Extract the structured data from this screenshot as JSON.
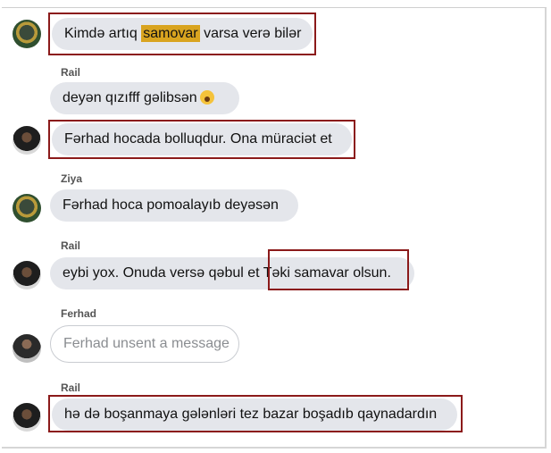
{
  "messages": [
    {
      "sender": "",
      "text_before": "Kimdə artıq ",
      "highlight": "samovar",
      "text_after": " varsa verə bilər"
    },
    {
      "sender": "Rail",
      "text": "deyən qızıfff gəlibsən",
      "emoji": "astonished-emoji"
    },
    {
      "sender": "",
      "text": "Fərhad hocada bolluqdur. Ona müraciət et"
    },
    {
      "sender": "Ziya",
      "text": "Fərhad hoca pomoalayıb deyəsən"
    },
    {
      "sender": "Rail",
      "text_plain": "eybi yox. Onuda versə qəbul et ",
      "text_boxed": "Təki samavar olsun."
    },
    {
      "sender": "Ferhad",
      "text": "Ferhad unsent a message"
    },
    {
      "sender": "Rail",
      "text": "hə də boşanmaya gələnləri tez bazar boşadıb qaynadardın"
    }
  ],
  "colors": {
    "bubble": "#e4e6eb",
    "highlight": "#d9a41f",
    "annotation_box": "#8b1a1a"
  }
}
